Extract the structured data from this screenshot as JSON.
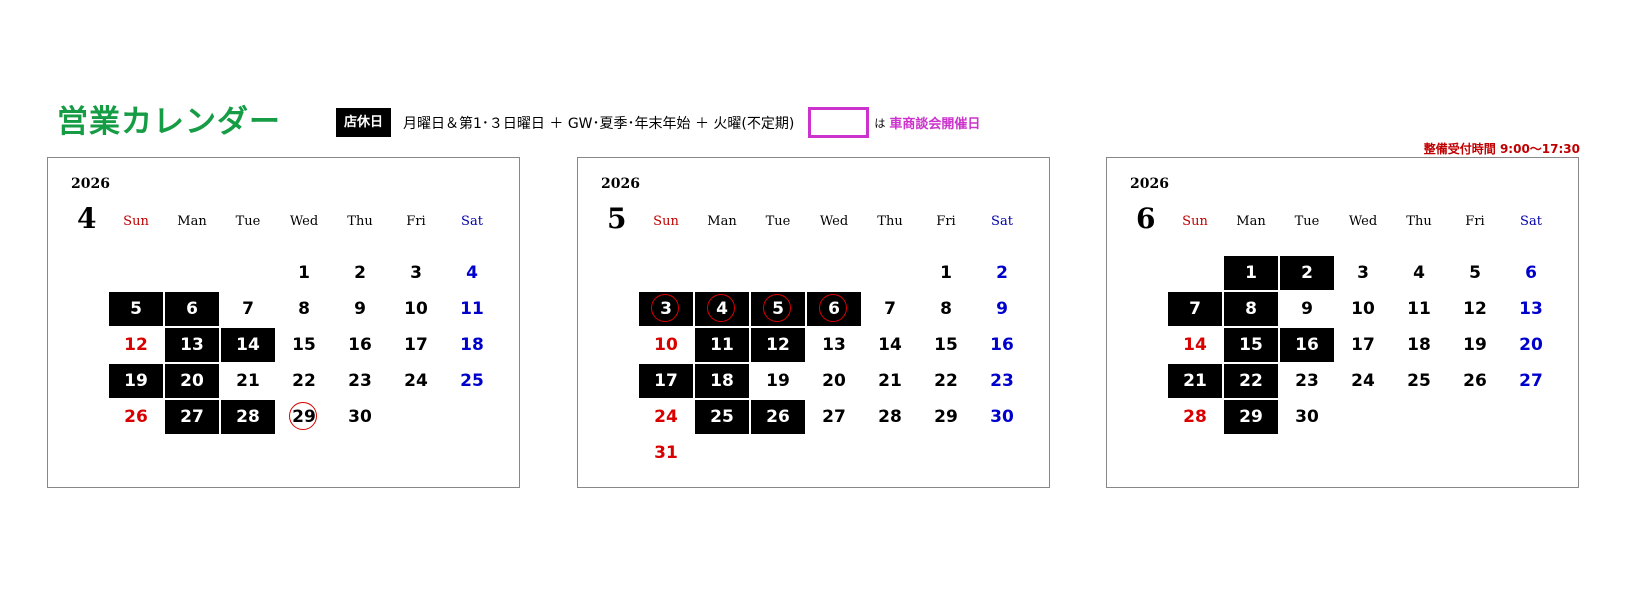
{
  "header": {
    "title": "営業カレンダー",
    "closed_badge": "店休日",
    "closed_rule": "月曜日＆第1･３日曜日 ＋ GW･夏季･年末年始 ＋ 火曜(不定期)",
    "event_particle": "は",
    "event_label": "車商談会開催日",
    "hours": "整備受付時間 9:00～17:30"
  },
  "colors": {
    "title": "#169c45",
    "closed": "#000000",
    "sunday": "#d90000",
    "saturday": "#0000cc",
    "event": "#cc33cc"
  },
  "weekdays": [
    "Sun",
    "Man",
    "Tue",
    "Wed",
    "Thu",
    "Fri",
    "Sat"
  ],
  "calendars": [
    {
      "year": "2026",
      "month": "4",
      "first_weekday": 3,
      "days": 30,
      "closed": [
        5,
        6,
        13,
        14,
        19,
        20,
        27,
        28
      ],
      "circled": [
        29
      ]
    },
    {
      "year": "2026",
      "month": "5",
      "first_weekday": 5,
      "days": 31,
      "closed": [
        3,
        4,
        5,
        6,
        11,
        12,
        17,
        18,
        25,
        26
      ],
      "circled": [
        3,
        4,
        5,
        6
      ]
    },
    {
      "year": "2026",
      "month": "6",
      "first_weekday": 1,
      "days": 30,
      "closed": [
        1,
        2,
        7,
        8,
        15,
        16,
        21,
        22,
        29
      ],
      "circled": []
    }
  ]
}
